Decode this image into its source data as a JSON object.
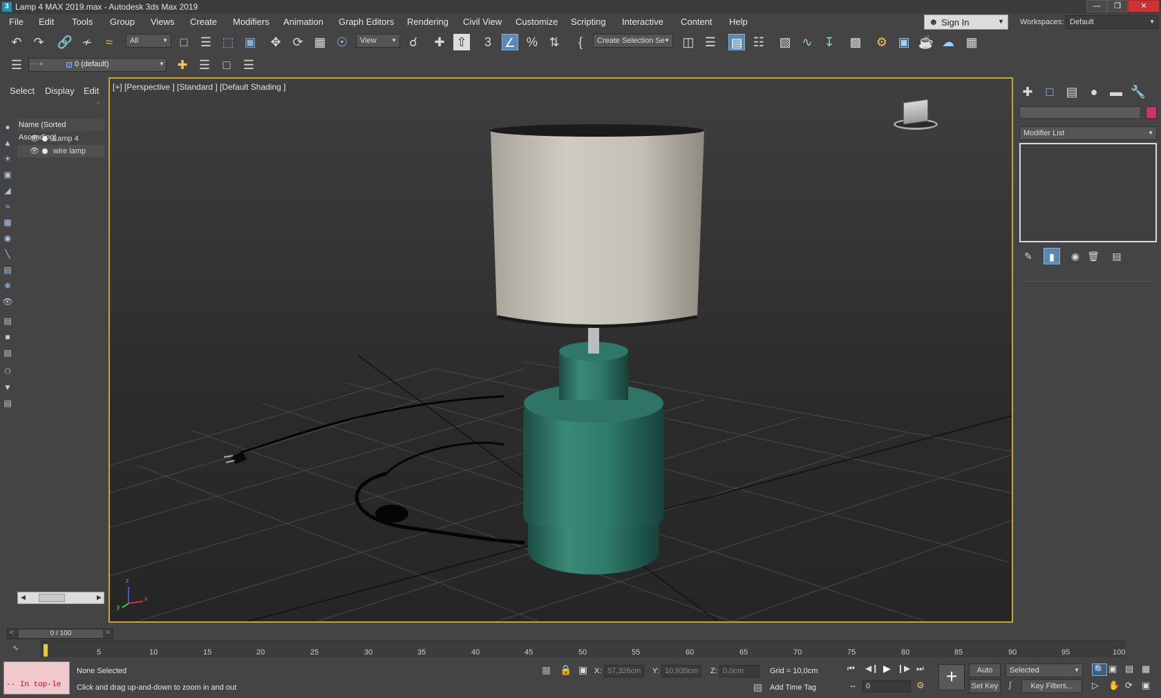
{
  "window": {
    "title": "Lamp 4 MAX 2019.max - Autodesk 3ds Max 2019",
    "app_icon": "3",
    "minimize": "—",
    "restore": "❐",
    "close": "✕"
  },
  "menu": [
    "File",
    "Edit",
    "Tools",
    "Group",
    "Views",
    "Create",
    "Modifiers",
    "Animation",
    "Graph Editors",
    "Rendering",
    "Civil View",
    "Customize",
    "Scripting",
    "Interactive",
    "Content",
    "Help"
  ],
  "account": {
    "sign_in": "Sign In",
    "workspaces_label": "Workspaces:",
    "workspace_value": "Default"
  },
  "toolbar": {
    "selection_filter": "All",
    "reference_coord": "View",
    "selection_set": "Create Selection Se",
    "snap_value": "3"
  },
  "layer": {
    "current": "0 (default)"
  },
  "scene_explorer": {
    "tabs": [
      "Select",
      "Display",
      "Edit"
    ],
    "column_header": "Name (Sorted Ascending)",
    "items": [
      "Lamp 4",
      "wire lamp"
    ]
  },
  "viewport": {
    "label": "[+] [Perspective ] [Standard ] [Default Shading ]",
    "axis_x": "x",
    "axis_y": "y",
    "axis_z": "z"
  },
  "command_panel": {
    "modifier_list": "Modifier List"
  },
  "timeline": {
    "frame_counter": "0 / 100",
    "ticks": [
      "5",
      "10",
      "15",
      "20",
      "25",
      "30",
      "35",
      "40",
      "45",
      "50",
      "55",
      "60",
      "65",
      "70",
      "75",
      "80",
      "85",
      "90",
      "95",
      "100"
    ]
  },
  "status": {
    "maxscript_text": "-- In top-le",
    "selection": "None Selected",
    "prompt": "Click and drag up-and-down to zoom in and out",
    "x_label": "X:",
    "x_value": "57,326cm",
    "y_label": "Y:",
    "y_value": "10,935cm",
    "z_label": "Z:",
    "z_value": "0,0cm",
    "grid": "Grid = 10,0cm",
    "add_time_tag": "Add Time Tag",
    "auto_key": "Auto Key",
    "set_key": "Set Key",
    "selected": "Selected",
    "key_filters": "Key Filters...",
    "frame_field": "0"
  },
  "colors": {
    "viewport_border": "#c9a534",
    "accent_active": "#5b87b3",
    "swatch": "#d0306f"
  }
}
